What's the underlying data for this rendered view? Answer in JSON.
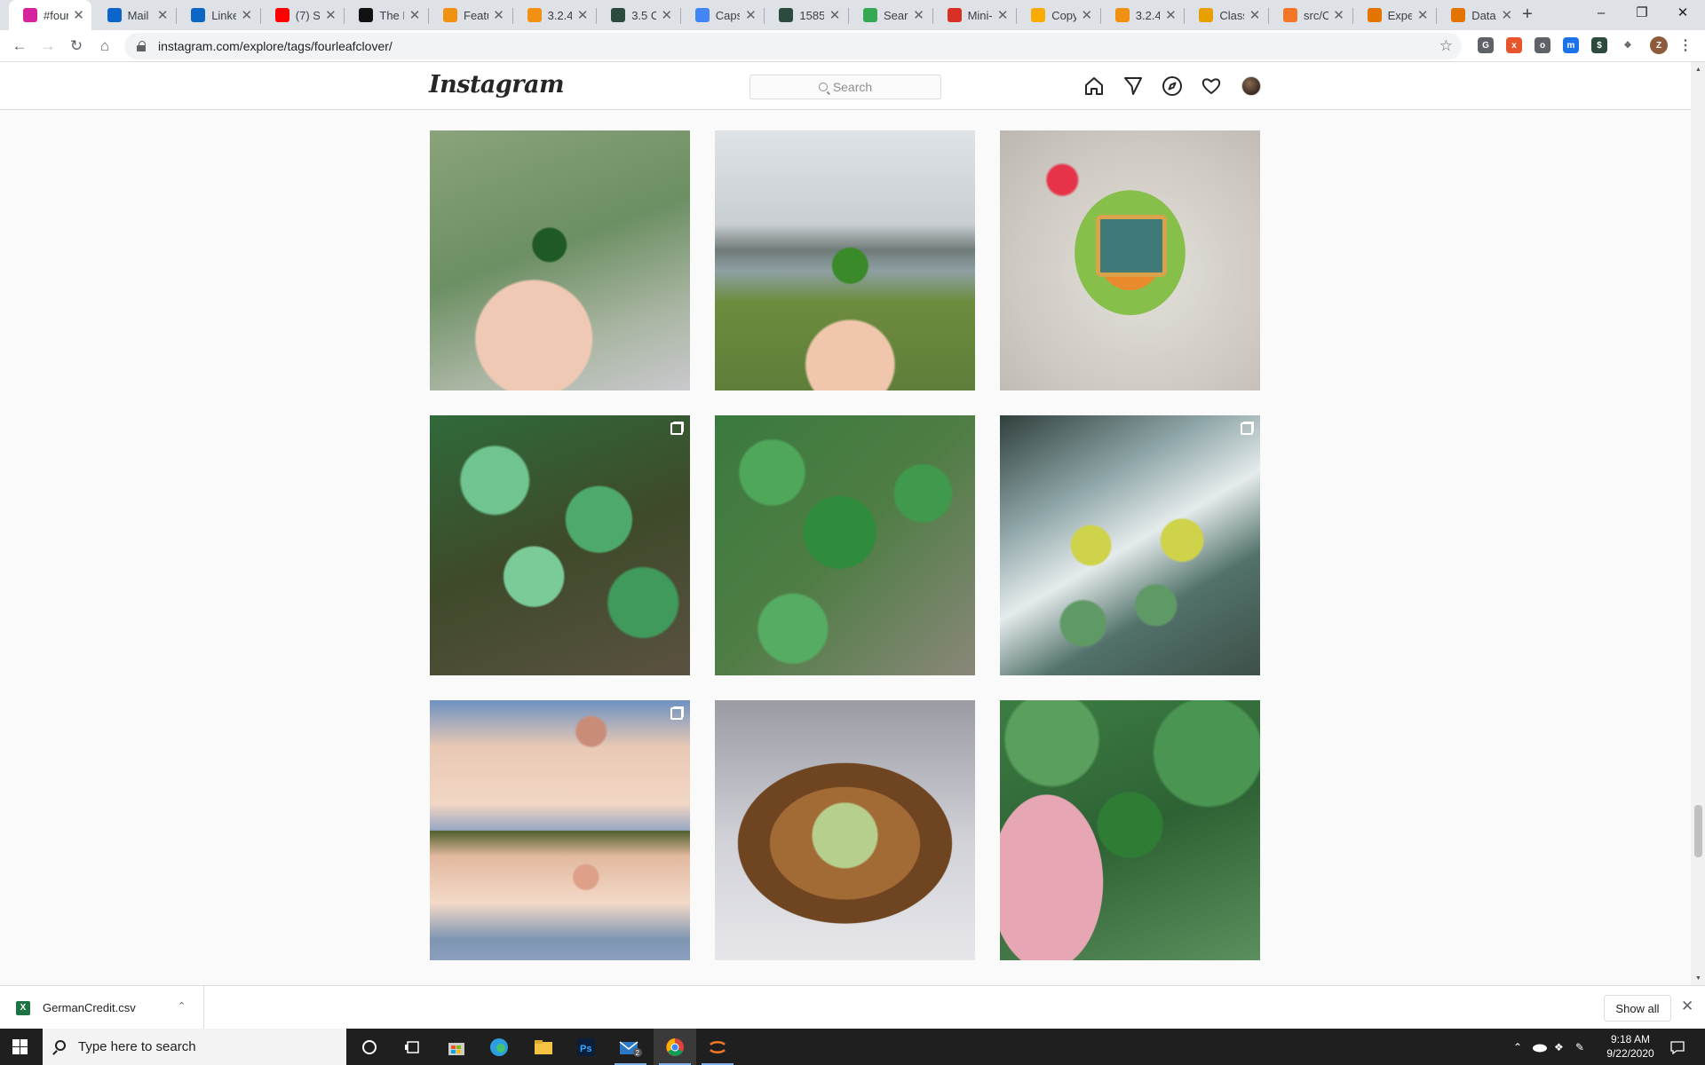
{
  "browser": {
    "tabs": [
      {
        "title": "#four",
        "favicon": "instagram-icon",
        "color": "#d6249f",
        "active": true
      },
      {
        "title": "Mail -",
        "favicon": "outlook-icon",
        "color": "#0a64c9"
      },
      {
        "title": "Linke",
        "favicon": "linkedin-icon",
        "color": "#0a66c2"
      },
      {
        "title": "(7) Su",
        "favicon": "youtube-icon",
        "color": "#ff0000"
      },
      {
        "title": "The N",
        "favicon": "nyt-icon",
        "color": "#111111"
      },
      {
        "title": "Featu",
        "favicon": "chart-icon",
        "color": "#f29111"
      },
      {
        "title": "3.2.4.",
        "favicon": "chart-icon",
        "color": "#f29111"
      },
      {
        "title": "3.5 Cl",
        "favicon": "dollar-icon",
        "color": "#2d4a3e"
      },
      {
        "title": "Capst",
        "favicon": "docs-icon",
        "color": "#4285f4"
      },
      {
        "title": "1585!",
        "favicon": "dollar-icon",
        "color": "#2d4a3e"
      },
      {
        "title": "Searc",
        "favicon": "drive-icon",
        "color": "#34a853"
      },
      {
        "title": "Mini-",
        "favicon": "glasses-icon",
        "color": "#d93025"
      },
      {
        "title": "Copy",
        "favicon": "link-icon",
        "color": "#f9ab00"
      },
      {
        "title": "3.2.4.",
        "favicon": "chart-icon",
        "color": "#f29111"
      },
      {
        "title": "Class",
        "favicon": "ni-icon",
        "color": "#e8a000"
      },
      {
        "title": "src/C",
        "favicon": "jupyter-icon",
        "color": "#f37726"
      },
      {
        "title": "Expe",
        "favicon": "book-icon",
        "color": "#e37400"
      },
      {
        "title": "Data",
        "favicon": "book-icon",
        "color": "#e37400"
      }
    ],
    "address": "instagram.com/explore/tags/fourleafclover/",
    "extensions": [
      {
        "name": "grammarly-icon",
        "label": "G",
        "color": "#5f6368"
      },
      {
        "name": "ext-orange-icon",
        "label": "x",
        "color": "#e8552d"
      },
      {
        "name": "ext-circle-icon",
        "label": "o",
        "color": "#5f6368"
      },
      {
        "name": "ext-m-icon",
        "label": "m",
        "color": "#1a73e8"
      },
      {
        "name": "ext-dollar-icon",
        "label": "$",
        "color": "#2d4a3e"
      },
      {
        "name": "extensions-puzzle-icon",
        "label": "",
        "color": "#5f6368"
      }
    ],
    "profile_initial": "Z"
  },
  "instagram": {
    "logo": "Instagram",
    "search_placeholder": "Search",
    "nav": [
      "home-icon",
      "direct-icon",
      "explore-icon",
      "activity-heart-icon",
      "profile-avatar"
    ],
    "posts": [
      {
        "desc": "hand holding four-leaf clover over grass",
        "multi": false
      },
      {
        "desc": "hand holding four-leaf clover by river",
        "multi": false
      },
      {
        "desc": "tamagotchi-style toy on fluffy rug",
        "multi": false
      },
      {
        "desc": "clover patch on dirt",
        "multi": true
      },
      {
        "desc": "close-up four-leaf clover",
        "multi": false
      },
      {
        "desc": "clover charm earrings on agate",
        "multi": true
      },
      {
        "desc": "rose-gold clover bracelet on wrist",
        "multi": true
      },
      {
        "desc": "green clover soap on wooden dish",
        "multi": false
      },
      {
        "desc": "fingers holding clover leaf",
        "multi": false
      }
    ]
  },
  "downloads": {
    "file": "GermanCredit.csv",
    "show_all": "Show all"
  },
  "taskbar": {
    "search_placeholder": "Type here to search",
    "badge": "2",
    "time": "9:18 AM",
    "date": "9/22/2020"
  }
}
